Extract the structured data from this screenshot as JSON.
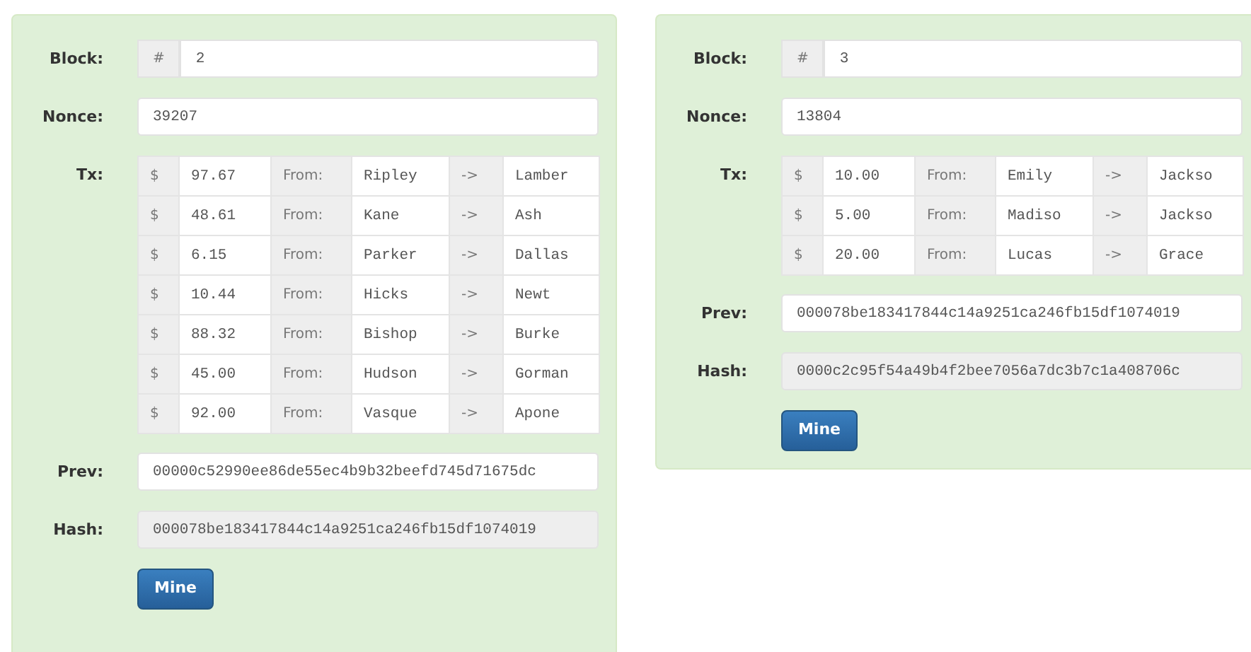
{
  "blocks": [
    {
      "block_label": "Block:",
      "block_prefix": "#",
      "block": "2",
      "nonce_label": "Nonce:",
      "nonce": "39207",
      "tx_label": "Tx:",
      "tx": [
        {
          "currency": "$",
          "amount": "97.67",
          "from_label": "From:",
          "from": "Ripley",
          "arrow": "->",
          "to": "Lamber"
        },
        {
          "currency": "$",
          "amount": "48.61",
          "from_label": "From:",
          "from": "Kane",
          "arrow": "->",
          "to": "Ash"
        },
        {
          "currency": "$",
          "amount": "6.15",
          "from_label": "From:",
          "from": "Parker",
          "arrow": "->",
          "to": "Dallas"
        },
        {
          "currency": "$",
          "amount": "10.44",
          "from_label": "From:",
          "from": "Hicks",
          "arrow": "->",
          "to": "Newt"
        },
        {
          "currency": "$",
          "amount": "88.32",
          "from_label": "From:",
          "from": "Bishop",
          "arrow": "->",
          "to": "Burke"
        },
        {
          "currency": "$",
          "amount": "45.00",
          "from_label": "From:",
          "from": "Hudson",
          "arrow": "->",
          "to": "Gorman"
        },
        {
          "currency": "$",
          "amount": "92.00",
          "from_label": "From:",
          "from": "Vasque",
          "arrow": "->",
          "to": "Apone"
        }
      ],
      "prev_label": "Prev:",
      "prev": "00000c52990ee86de55ec4b9b32beefd745d71675dc",
      "hash_label": "Hash:",
      "hash": "000078be183417844c14a9251ca246fb15df1074019",
      "hash_disabled": true,
      "button": "Mine"
    },
    {
      "block_label": "Block:",
      "block_prefix": "#",
      "block": "3",
      "nonce_label": "Nonce:",
      "nonce": "13804",
      "tx_label": "Tx:",
      "tx": [
        {
          "currency": "$",
          "amount": "10.00",
          "from_label": "From:",
          "from": "Emily",
          "arrow": "->",
          "to": "Jackso"
        },
        {
          "currency": "$",
          "amount": "5.00",
          "from_label": "From:",
          "from": "Madiso",
          "arrow": "->",
          "to": "Jackso"
        },
        {
          "currency": "$",
          "amount": "20.00",
          "from_label": "From:",
          "from": "Lucas",
          "arrow": "->",
          "to": "Grace"
        }
      ],
      "prev_label": "Prev:",
      "prev": "000078be183417844c14a9251ca246fb15df1074019",
      "hash_label": "Hash:",
      "hash": "0000c2c95f54a49b4f2bee7056a7dc3b7c1a408706c",
      "hash_disabled": true,
      "button": "Mine"
    }
  ]
}
